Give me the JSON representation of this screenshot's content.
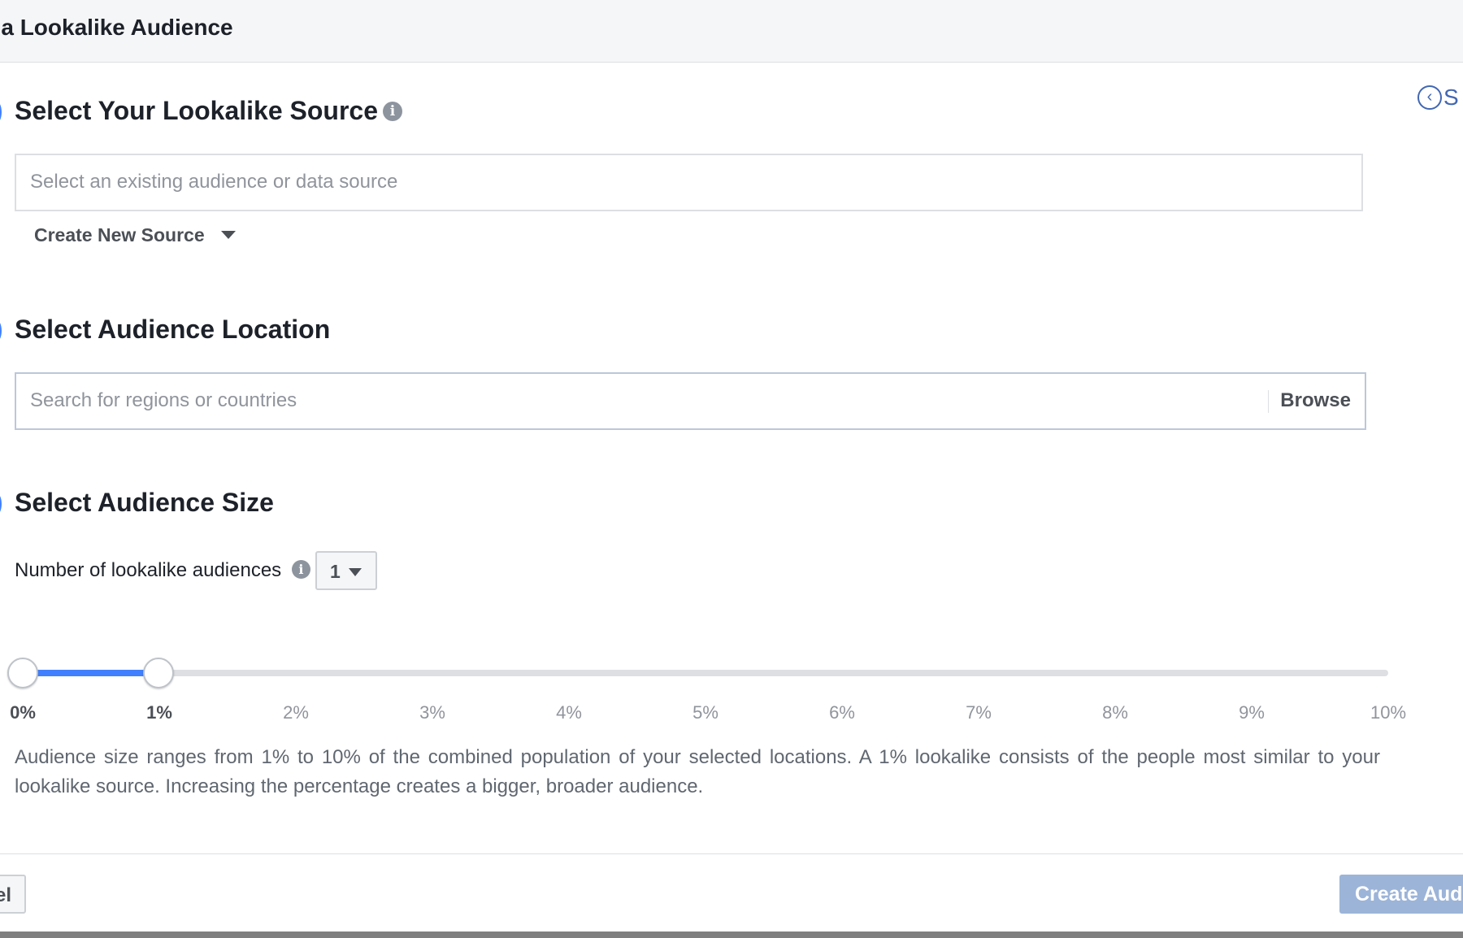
{
  "header": {
    "title": "e a Lookalike Audience"
  },
  "side_link": {
    "label": "S"
  },
  "sections": {
    "source": {
      "title": "Select Your Lookalike Source",
      "input_placeholder": "Select an existing audience or data source",
      "create_new_label": "Create New Source"
    },
    "location": {
      "title": "Select Audience Location",
      "input_placeholder": "Search for regions or countries",
      "browse_label": "Browse"
    },
    "size": {
      "title": "Select Audience Size",
      "number_label": "Number of lookalike audiences",
      "number_value": "1",
      "slider": {
        "min_percent": 0,
        "max_percent": 10,
        "range_start_percent": 0,
        "range_end_percent": 1,
        "ticks": [
          "0%",
          "1%",
          "2%",
          "3%",
          "4%",
          "5%",
          "6%",
          "7%",
          "8%",
          "9%",
          "10%"
        ]
      },
      "description": "Audience size ranges from 1% to 10% of the combined population of your selected locations. A 1% lookalike consists of the people most similar to your lookalike source. Increasing the percentage creates a bigger, broader audience."
    }
  },
  "footer": {
    "cancel_label": "el",
    "create_label": "Create Audi"
  },
  "icons": {
    "info": "info-icon",
    "caret": "chevron-down-icon",
    "back": "chevron-left-circle-icon"
  },
  "colors": {
    "accent": "#4080ff",
    "link": "#4267b2",
    "primary_button_disabled": "#9cb4d8"
  }
}
